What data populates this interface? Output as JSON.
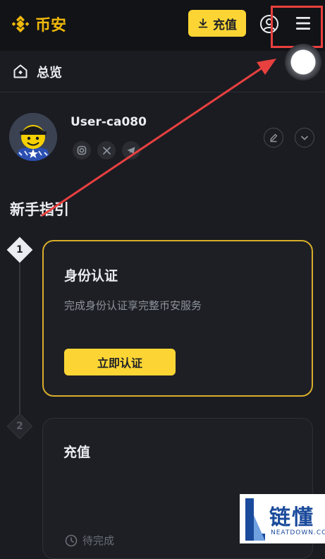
{
  "header": {
    "brand": "币安",
    "deposit_label": "充值",
    "brand_color": "#F0B90B",
    "accent_color": "#FCD535"
  },
  "breadcrumb": {
    "label": "总览",
    "icon": "home-icon"
  },
  "profile": {
    "username": "User-ca080",
    "socials": [
      "instagram-icon",
      "x-icon",
      "telegram-icon"
    ]
  },
  "guide": {
    "title": "新手指引",
    "steps": [
      {
        "number": "1",
        "title": "身份认证",
        "description": "完成身份认证享完整币安服务",
        "button_label": "立即认证",
        "state": "active"
      },
      {
        "number": "2",
        "title": "充值",
        "status": "待完成",
        "state": "pending"
      }
    ]
  },
  "annotation": {
    "color": "#E8403F"
  },
  "watermark": {
    "text": "链懂",
    "subtext": "NEATDOWN.COM"
  }
}
